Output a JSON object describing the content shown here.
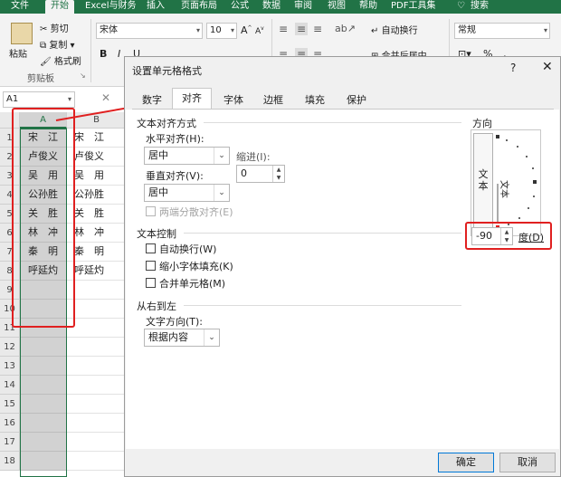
{
  "ribbon": {
    "tabs": [
      "文件",
      "开始",
      "Excel与财务",
      "插入",
      "页面布局",
      "公式",
      "数据",
      "审阅",
      "视图",
      "帮助",
      "PDF工具集",
      "搜索"
    ],
    "active_tab": "开始",
    "clipboard": {
      "paste": "粘贴",
      "cut": "剪切",
      "copy": "复制",
      "format_painter": "格式刷",
      "group": "剪贴板"
    },
    "font_name": "宋体",
    "font_size": "10",
    "bold": "B",
    "italic": "I",
    "underline": "U",
    "grow_font": "A",
    "shrink_font": "A",
    "wrap_text": "自动换行",
    "merge_center": "合并后居中",
    "number_format": "常规",
    "percent": "%",
    "comma": ","
  },
  "namebox": "A1",
  "sheet": {
    "columns": [
      "A",
      "B"
    ],
    "rows": [
      "1",
      "2",
      "3",
      "4",
      "5",
      "6",
      "7",
      "8",
      "9",
      "10",
      "11",
      "12",
      "13",
      "14",
      "15",
      "16",
      "17",
      "18"
    ],
    "colA": [
      "宋　江",
      "卢俊义",
      "吴　用",
      "公孙胜",
      "关　胜",
      "林　冲",
      "秦　明",
      "呼延灼"
    ],
    "colB": [
      "宋　江",
      "卢俊义",
      "吴　用",
      "公孙胜",
      "关　胜",
      "林　冲",
      "秦　明",
      "呼延灼"
    ]
  },
  "dialog": {
    "title": "设置单元格格式",
    "help": "?",
    "close": "✕",
    "tabs": [
      "数字",
      "对齐",
      "字体",
      "边框",
      "填充",
      "保护"
    ],
    "active_tab": "对齐",
    "text_alignment": {
      "heading": "文本对齐方式",
      "horizontal_label": "水平对齐(H):",
      "horizontal_value": "居中",
      "indent_label": "缩进(I):",
      "indent_value": "0",
      "vertical_label": "垂直对齐(V):",
      "vertical_value": "居中",
      "justify_distributed": "两端分散对齐(E)"
    },
    "text_control": {
      "heading": "文本控制",
      "wrap": "自动换行(W)",
      "shrink": "缩小字体填充(K)",
      "merge": "合并单元格(M)"
    },
    "rtl": {
      "heading": "从右到左",
      "direction_label": "文字方向(T):",
      "direction_value": "根据内容"
    },
    "orientation": {
      "heading": "方向",
      "vertical_text": "文本",
      "rotated_text": "文本",
      "degrees_value": "-90",
      "degrees_label": "度(D)"
    },
    "ok": "确定",
    "cancel": "取消"
  },
  "colors": {
    "accent": "#217346",
    "highlight": "#e02020",
    "selected_cell": "#d2d2d2"
  }
}
